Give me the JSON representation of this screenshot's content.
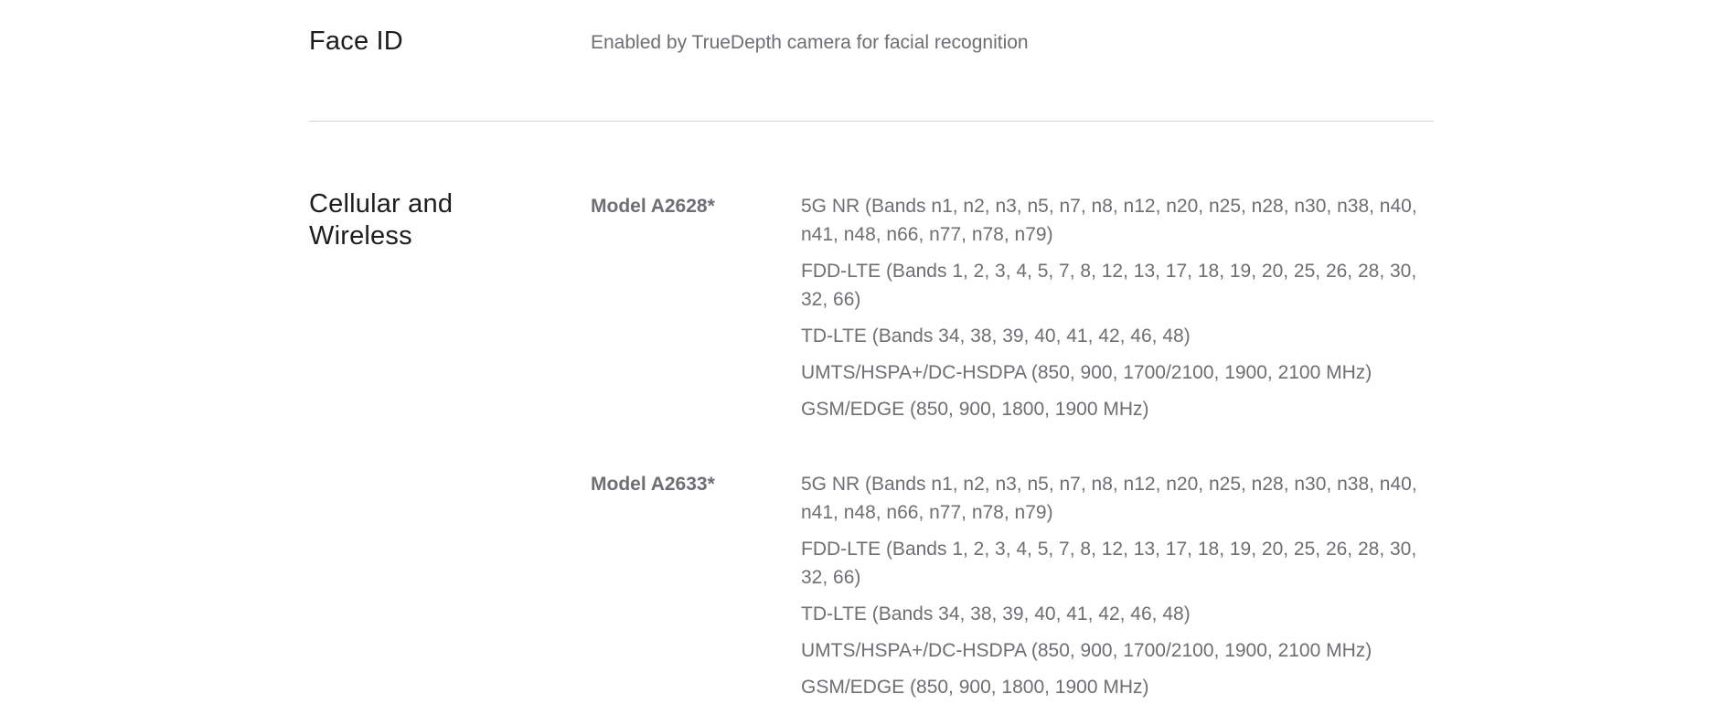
{
  "face_id": {
    "title": "Face ID",
    "description": "Enabled by TrueDepth camera for facial recognition"
  },
  "cellular": {
    "title": "Cellular and Wireless",
    "models": [
      {
        "name": "Model A2628*",
        "bands": [
          "5G NR (Bands n1, n2, n3, n5, n7, n8, n12, n20, n25, n28, n30, n38, n40, n41, n48, n66, n77, n78, n79)",
          "FDD-LTE (Bands 1, 2, 3, 4, 5, 7, 8, 12, 13, 17, 18, 19, 20, 25, 26, 28, 30, 32, 66)",
          "TD-LTE (Bands 34, 38, 39, 40, 41, 42, 46, 48)",
          "UMTS/HSPA+/DC-HSDPA (850, 900, 1700/2100, 1900, 2100 MHz)",
          "GSM/EDGE (850, 900, 1800, 1900 MHz)"
        ]
      },
      {
        "name": "Model A2633*",
        "bands": [
          "5G NR (Bands n1, n2, n3, n5, n7, n8, n12, n20, n25, n28, n30, n38, n40, n41, n48, n66, n77, n78, n79)",
          "FDD-LTE (Bands 1, 2, 3, 4, 5, 7, 8, 12, 13, 17, 18, 19, 20, 25, 26, 28, 30, 32, 66)",
          "TD-LTE (Bands 34, 38, 39, 40, 41, 42, 46, 48)",
          "UMTS/HSPA+/DC-HSDPA (850, 900, 1700/2100, 1900, 2100 MHz)",
          "GSM/EDGE (850, 900, 1800, 1900 MHz)"
        ]
      }
    ]
  }
}
